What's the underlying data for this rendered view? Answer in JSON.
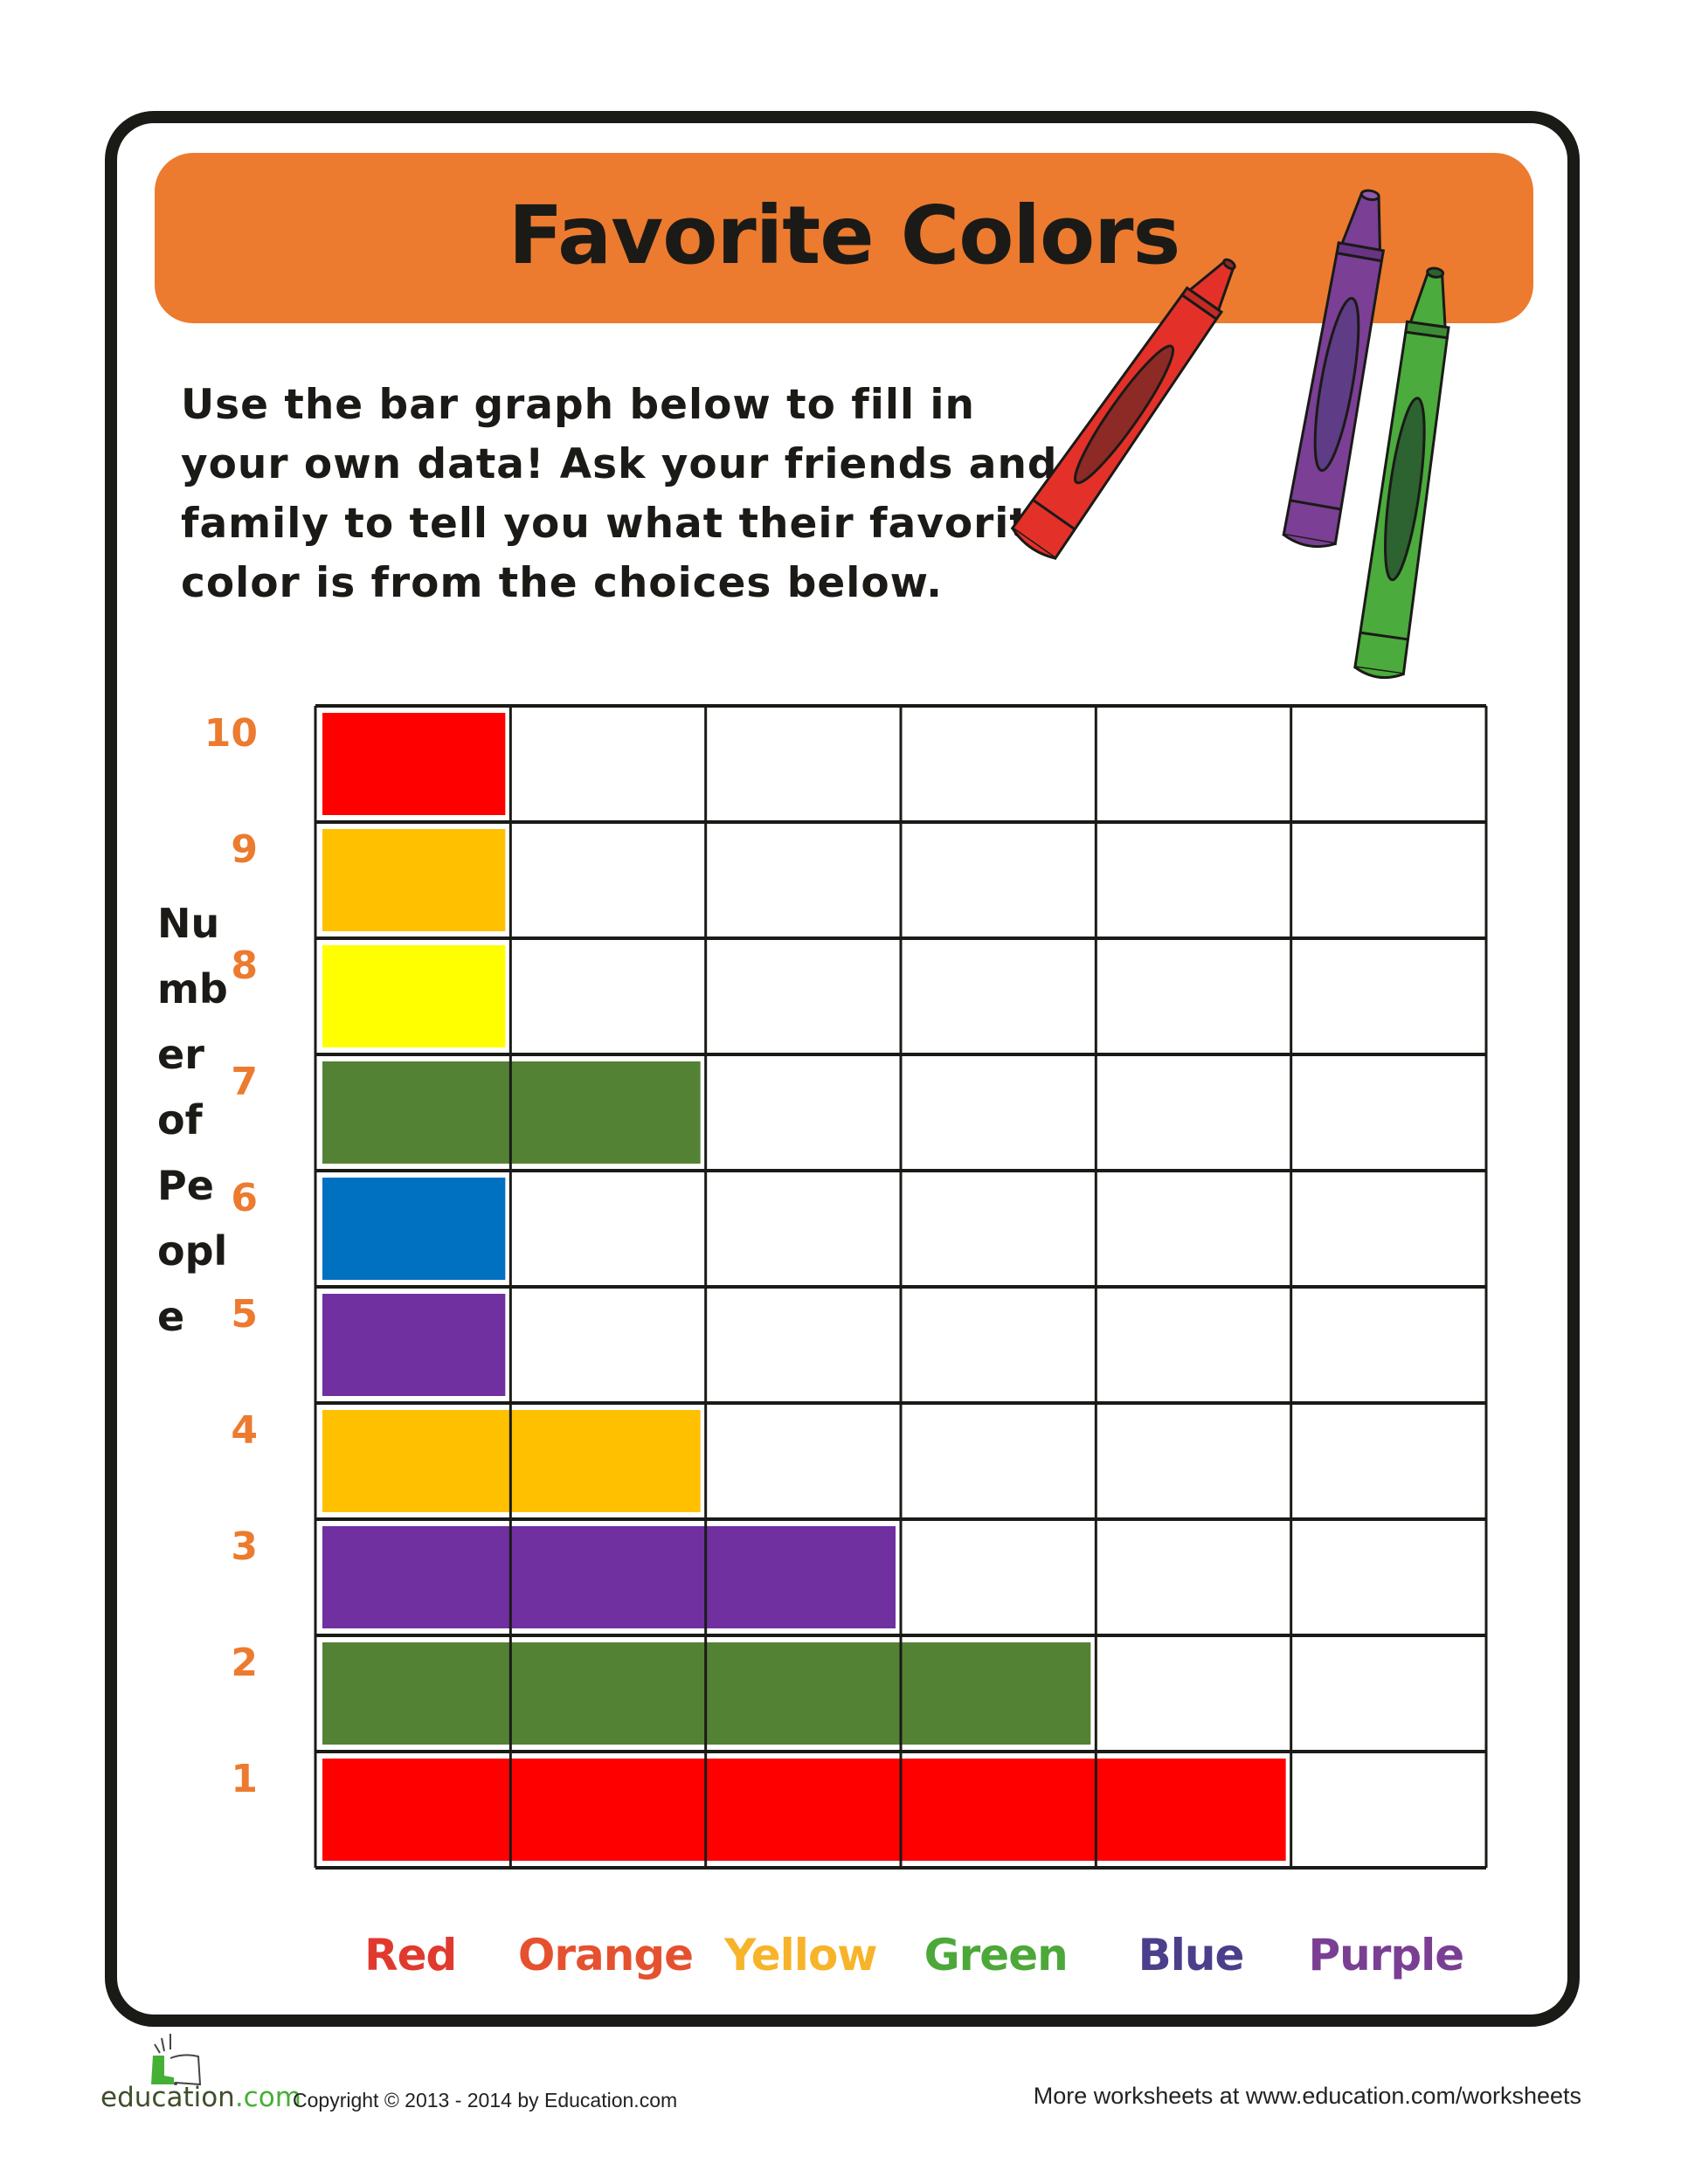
{
  "worksheet": {
    "title": "Favorite Colors",
    "instructions": [
      "Use the bar graph below to fill in",
      "your own data! Ask your friends and",
      "family to tell you what their favorite",
      "color is from the choices below."
    ],
    "banner_color": "#ec7b2f",
    "crayon_icons": [
      "red-crayon",
      "purple-crayon",
      "green-crayon"
    ]
  },
  "chart_data": {
    "type": "table",
    "title": "Favorite Colors",
    "xlabel": "",
    "ylabel_fragments": [
      "Nu",
      "mb",
      "er",
      "of",
      "Pe",
      "opl",
      "e"
    ],
    "ylabel": "Number of People",
    "categories": [
      "Red",
      "Orange",
      "Yellow",
      "Green",
      "Blue",
      "Purple"
    ],
    "category_colors": [
      "#e03a2f",
      "#e5512f",
      "#f7b42a",
      "#4da83a",
      "#4b3f8c",
      "#7a3f92"
    ],
    "y_ticks": [
      10,
      9,
      8,
      7,
      6,
      5,
      4,
      3,
      2,
      1
    ],
    "ylim": [
      0,
      10
    ],
    "grid": true,
    "tick_color": "#ec7b2f",
    "filled_rows": [
      {
        "row": 10,
        "cells_filled": 1,
        "color": "#ff0000"
      },
      {
        "row": 9,
        "cells_filled": 1,
        "color": "#ffc000"
      },
      {
        "row": 8,
        "cells_filled": 1,
        "color": "#ffff00"
      },
      {
        "row": 7,
        "cells_filled": 2,
        "color": "#548235"
      },
      {
        "row": 6,
        "cells_filled": 1,
        "color": "#0070c0"
      },
      {
        "row": 5,
        "cells_filled": 1,
        "color": "#7030a0"
      },
      {
        "row": 4,
        "cells_filled": 2,
        "color": "#ffc000"
      },
      {
        "row": 3,
        "cells_filled": 3,
        "color": "#7030a0"
      },
      {
        "row": 2,
        "cells_filled": 4,
        "color": "#548235"
      },
      {
        "row": 1,
        "cells_filled": 5,
        "color": "#ff0000"
      }
    ]
  },
  "footer": {
    "logo_main": "education",
    "logo_suffix": ".com",
    "copyright": "Copyright © 2013 - 2014  by Education.com",
    "more_link": "More worksheets at www.education.com/worksheets"
  }
}
